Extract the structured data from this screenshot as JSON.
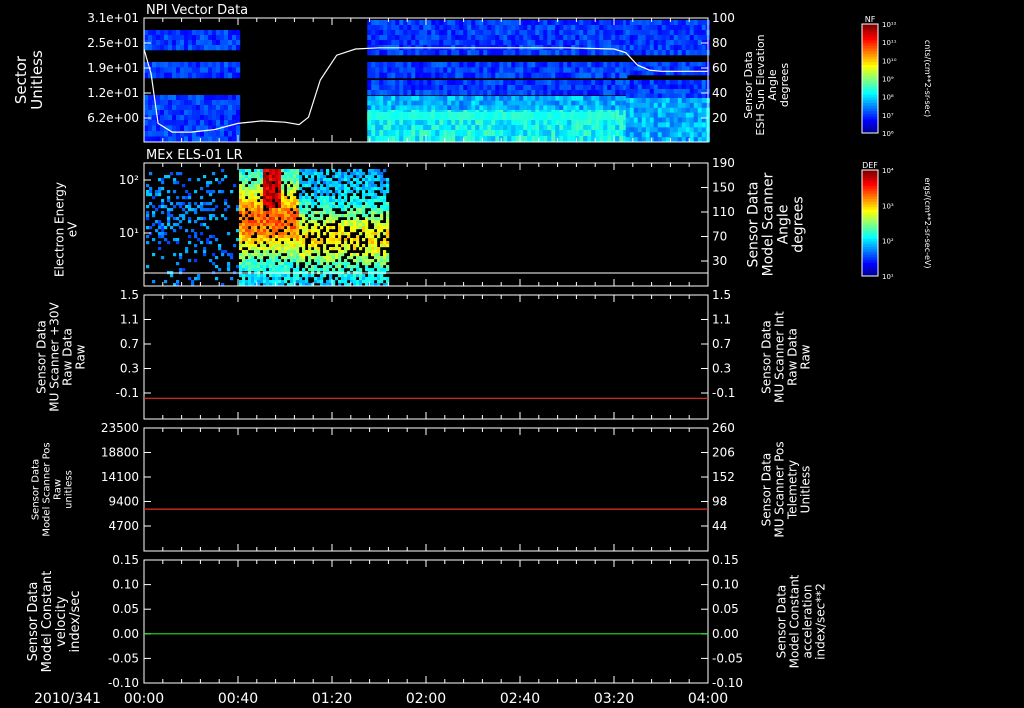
{
  "figure": {
    "date_label": "2010/341"
  },
  "time_axis": {
    "ticks": [
      "00:00",
      "00:40",
      "01:20",
      "02:00",
      "02:40",
      "03:20",
      "04:00"
    ],
    "start_min": 0,
    "end_min": 240
  },
  "colors": {
    "red": "#e8302a",
    "green": "#22e022",
    "white": "#ffffff",
    "bg": "#000000"
  },
  "chart_data": [
    {
      "type": "heatmap",
      "title": "NPI Vector Data",
      "ylabel": [
        "Sector",
        "Unitless"
      ],
      "yticks": [
        "3.1e+01",
        "2.5e+01",
        "1.9e+01",
        "1.2e+01",
        "6.2e+00"
      ],
      "y2label": [
        "Sensor Data",
        "ESH Sun Elevation",
        "Angle",
        "degrees"
      ],
      "y2ticks": [
        "100",
        "80",
        "60",
        "40",
        "20"
      ],
      "y2lim": [
        0,
        100
      ],
      "colorbar": {
        "label": "NF",
        "unit": "cnts/(cm**2-sr-sec)",
        "ticks": [
          "10¹²",
          "10¹¹",
          "10¹⁰",
          "10⁹",
          "10⁸",
          "10⁷",
          "10⁶"
        ]
      },
      "line_series": {
        "name": "ESH Sun Elevation Angle",
        "x_min": [
          0,
          3,
          6,
          12,
          20,
          30,
          40,
          50,
          60,
          66,
          70,
          75,
          82,
          90,
          100,
          120,
          150,
          180,
          200,
          205,
          210,
          215,
          220,
          240
        ],
        "y": [
          75,
          55,
          15,
          8,
          8,
          10,
          15,
          17,
          16,
          14,
          20,
          50,
          70,
          75,
          76,
          76,
          76,
          76,
          75,
          72,
          62,
          58,
          57,
          57
        ]
      }
    },
    {
      "type": "heatmap",
      "title": "MEx ELS-01 LR",
      "ylabel": [
        "Electron Energy",
        "eV"
      ],
      "yticks": [
        "10²",
        "10¹"
      ],
      "y2label": [
        "Sensor Data",
        "Model Scanner",
        "Angle",
        "degrees"
      ],
      "y2ticks": [
        "190",
        "150",
        "110",
        "70",
        "30"
      ],
      "y2lim": [
        -10,
        190
      ],
      "colorbar": {
        "label": "DEF",
        "unit": "ergs/(cm**2-sr-sec-eV)",
        "ticks": [
          "10⁴",
          "10³",
          "10²",
          "10¹"
        ]
      },
      "line_series": {
        "name": "Model Scanner Angle",
        "x_min": [
          0,
          240
        ],
        "y": [
          0,
          0
        ]
      }
    },
    {
      "type": "line",
      "ylabel": [
        "Sensor Data",
        "MU Scanner +30V",
        "Raw Data",
        "Raw"
      ],
      "yticks": [
        "1.5",
        "1.1",
        "0.7",
        "0.3",
        "-0.1"
      ],
      "ylim": [
        -0.3,
        1.5
      ],
      "y2label": [
        "Sensor Data",
        "MU Scanner Int",
        "Raw Data",
        "Raw"
      ],
      "y2ticks": [
        "1.5",
        "1.1",
        "0.7",
        "0.3",
        "-0.1"
      ],
      "series": [
        {
          "name": "MU Scanner Int Raw Data",
          "color": "#e8302a",
          "x_min": [
            0,
            240
          ],
          "y": [
            0.0,
            0.0
          ]
        }
      ]
    },
    {
      "type": "line",
      "ylabel": [
        "Sensor Data",
        "Model Scanner Pos",
        "Raw",
        "unitless"
      ],
      "yticks": [
        "23500",
        "18800",
        "14100",
        "9400",
        "4700"
      ],
      "ylim": [
        0,
        23500
      ],
      "y2label": [
        "Sensor Data",
        "MU Scanner Pos",
        "Telemetry",
        "Unitless"
      ],
      "y2ticks": [
        "260",
        "206",
        "152",
        "98",
        "44"
      ],
      "series": [
        {
          "name": "MU Scanner Pos Telemetry",
          "color": "#e8302a",
          "x_min": [
            0,
            240
          ],
          "y": [
            8000,
            8000
          ]
        }
      ]
    },
    {
      "type": "line",
      "ylabel": [
        "Sensor Data",
        "Model Constant",
        "velocity",
        "index/sec"
      ],
      "yticks": [
        "0.15",
        "0.10",
        "0.05",
        "0.00",
        "-0.05",
        "-0.10"
      ],
      "ylim": [
        -0.1,
        0.15
      ],
      "y2label": [
        "Sensor Data",
        "Model Constant",
        "acceleration",
        "index/sec**2"
      ],
      "y2ticks": [
        "0.15",
        "0.10",
        "0.05",
        "0.00",
        "-0.05",
        "-0.10"
      ],
      "series": [
        {
          "name": "Model Constant acceleration",
          "color": "#22e022",
          "x_min": [
            0,
            240
          ],
          "y": [
            0.0,
            0.0
          ]
        }
      ]
    }
  ]
}
